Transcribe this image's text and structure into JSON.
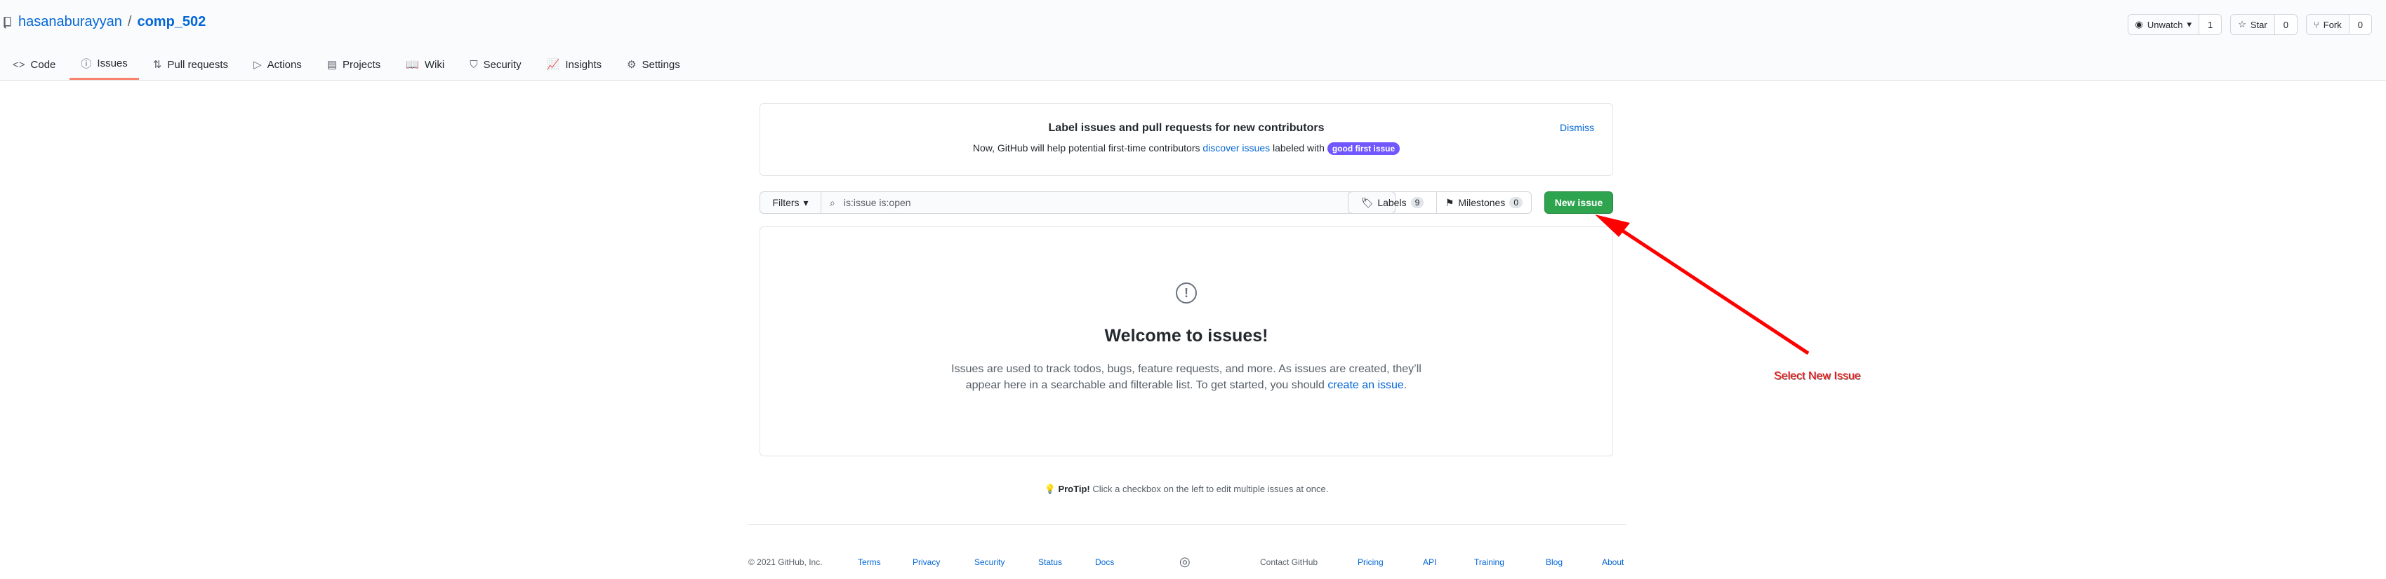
{
  "repo": {
    "owner": "hasanaburayyan",
    "separator": "/",
    "name": "comp_502"
  },
  "actions": {
    "watch": {
      "label": "Unwatch",
      "count": "1"
    },
    "star": {
      "label": "Star",
      "count": "0"
    },
    "fork": {
      "label": "Fork",
      "count": "0"
    }
  },
  "tabs": [
    {
      "label": "Code",
      "icon": "code-icon"
    },
    {
      "label": "Issues",
      "icon": "issue-icon"
    },
    {
      "label": "Pull requests",
      "icon": "pull-request-icon"
    },
    {
      "label": "Actions",
      "icon": "play-icon"
    },
    {
      "label": "Projects",
      "icon": "project-icon"
    },
    {
      "label": "Wiki",
      "icon": "book-icon"
    },
    {
      "label": "Security",
      "icon": "shield-icon"
    },
    {
      "label": "Insights",
      "icon": "graph-icon"
    },
    {
      "label": "Settings",
      "icon": "gear-icon"
    }
  ],
  "banner": {
    "title": "Label issues and pull requests for new contributors",
    "text_before": "Now, GitHub will help potential first-time contributors",
    "link": "discover issues",
    "text_after": "labeled with",
    "label": "good first issue",
    "dismiss": "Dismiss"
  },
  "filters": {
    "button": "Filters",
    "search_value": "is:issue is:open",
    "labels": {
      "label": "Labels",
      "count": "9"
    },
    "milestones": {
      "label": "Milestones",
      "count": "0"
    },
    "new_issue": "New issue"
  },
  "blank": {
    "title": "Welcome to issues!",
    "line1": "Issues are used to track todos, bugs, feature requests, and more. As issues are created, they’ll",
    "line2": "appear here in a searchable and filterable list. To get started, you should",
    "link": "create an issue",
    "end": "."
  },
  "protip": {
    "bold": "ProTip!",
    "text": "Click a checkbox on the left to edit multiple issues at once."
  },
  "footer": {
    "copyright": "© 2021 GitHub, Inc.",
    "links_left": [
      "Terms",
      "Privacy",
      "Security",
      "Status",
      "Docs"
    ],
    "links_right": [
      "Contact GitHub",
      "Pricing",
      "API",
      "Training",
      "Blog",
      "About"
    ]
  },
  "annotation": {
    "text": "Select New Issue",
    "color": "#ff0000"
  },
  "colors": {
    "primary": "#2ea44f",
    "link": "#0366d6",
    "tab_underline": "#f9826c",
    "label": "#7057ff"
  }
}
